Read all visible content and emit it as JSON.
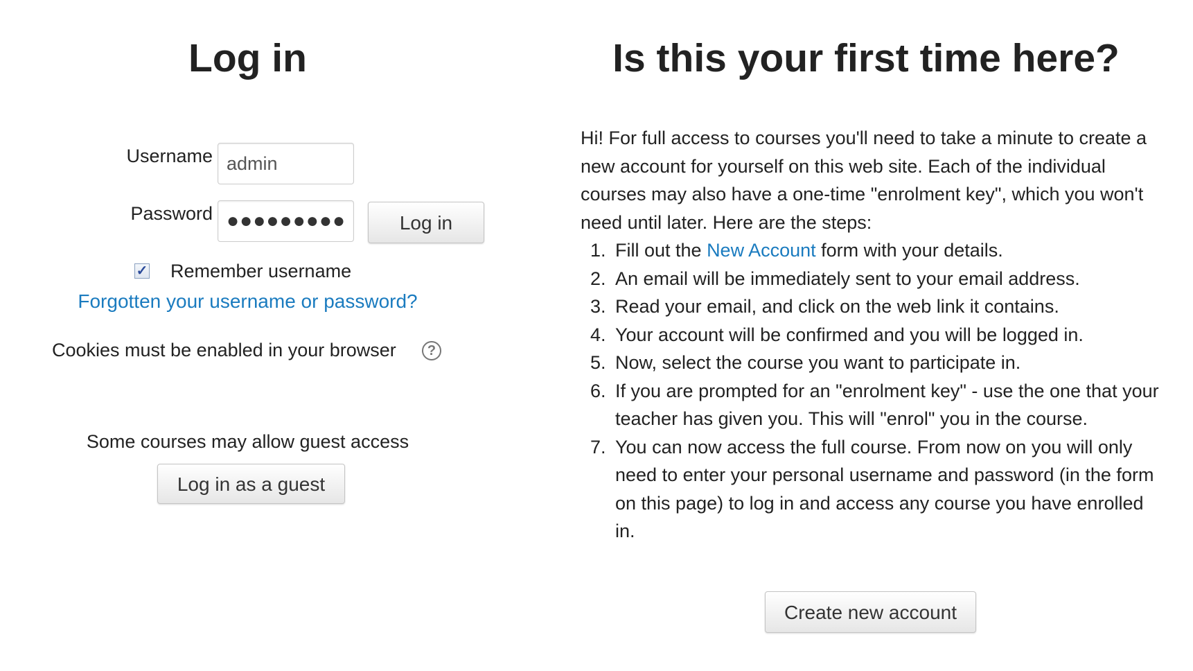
{
  "login": {
    "heading": "Log in",
    "username_label": "Username",
    "username_value": "admin",
    "password_label": "Password",
    "password_masked": "●●●●●●●●●",
    "login_button": "Log in",
    "remember_label": "Remember username",
    "remember_checked": true,
    "forgot_link": "Forgotten your username or password?",
    "cookies_text": "Cookies must be enabled in your browser",
    "help_icon": "question-circle-icon",
    "guest_text": "Some courses may allow guest access",
    "guest_button": "Log in as a guest"
  },
  "signup": {
    "heading": "Is this your first time here?",
    "intro": "Hi! For full access to courses you'll need to take a minute to create a new account for yourself on this web site. Each of the individual courses may also have a one-time \"enrolment key\", which you won't need until later. Here are the steps:",
    "steps": [
      {
        "num": "1.",
        "before": "Fill out the ",
        "link": "New Account",
        "after": " form with your details."
      },
      {
        "num": "2.",
        "text": "An email will be immediately sent to your email address."
      },
      {
        "num": "3.",
        "text": "Read your email, and click on the web link it contains."
      },
      {
        "num": "4.",
        "text": "Your account will be confirmed and you will be logged in."
      },
      {
        "num": "5.",
        "text": "Now, select the course you want to participate in."
      },
      {
        "num": "6.",
        "text": "If you are prompted for an \"enrolment key\" - use the one that your teacher has given you. This will \"enrol\" you in the course."
      },
      {
        "num": "7.",
        "text": "You can now access the full course. From now on you will only need to enter your personal username and password (in the form on this page) to log in and access any course you have enrolled in."
      }
    ],
    "create_button": "Create new account"
  },
  "colors": {
    "link": "#1a7bbf",
    "text": "#222222",
    "background": "#ffffff"
  }
}
